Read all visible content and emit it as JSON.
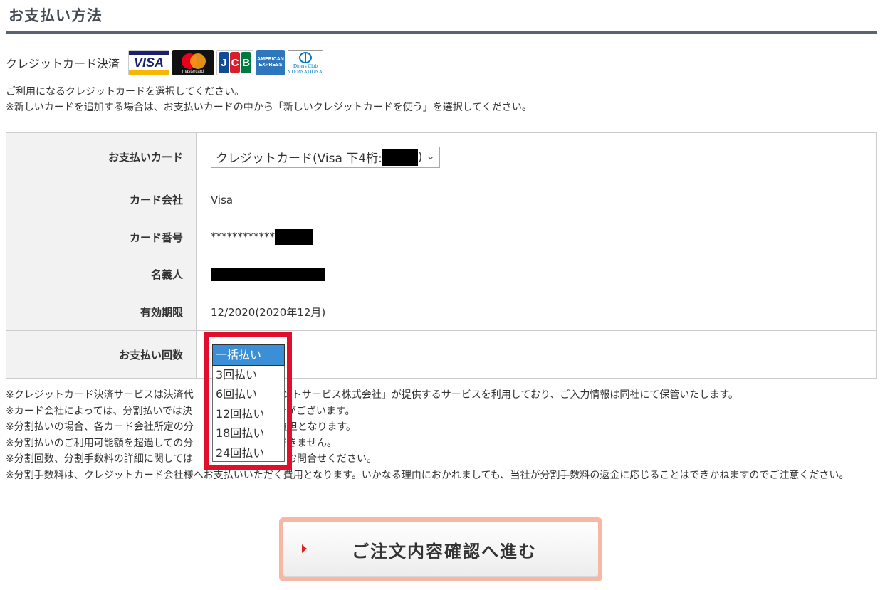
{
  "page_title": "お支払い方法",
  "credit": {
    "label": "クレジットカード決済",
    "logos": [
      {
        "name": "visa",
        "text": "VISA"
      },
      {
        "name": "mastercard",
        "text": "mastercard"
      },
      {
        "name": "jcb",
        "letters": [
          "J",
          "C",
          "B"
        ]
      },
      {
        "name": "amex",
        "text": "AMERICAN EXPRESS"
      },
      {
        "name": "diners",
        "text": "Diners Club INTERNATIONAL"
      }
    ]
  },
  "notes_top": [
    "ご利用になるクレジットカードを選択してください。",
    "※新しいカードを追加する場合は、お支払いカードの中から「新しいクレジットカードを使う」を選択してください。"
  ],
  "table": {
    "card_label": "お支払いカード",
    "card_value": "クレジットカード(Visa 下4桁:",
    "card_value_suffix": ")",
    "company_label": "カード会社",
    "company_value": "Visa",
    "number_label": "カード番号",
    "number_value": "************",
    "holder_label": "名義人",
    "expiry_label": "有効期限",
    "expiry_value": "12/2020(2020年12月)",
    "installments_label": "お支払い回数"
  },
  "installment_options": [
    "一括払い",
    "3回払い",
    "6回払い",
    "12回払い",
    "18回払い",
    "24回払い"
  ],
  "installment_selected": "一括払い",
  "notes_bottom": [
    "※クレジットカード決済サービスは決済代",
    "メントサービス株式会社」が提供するサービスを利用しており、ご入力情報は同社にて保管いたします。",
    "※カード会社によっては、分割払いでは決",
    "合がございます。",
    "※分割払いの場合、各カード会社所定の分",
    "負担となります。",
    "※分割払いのご利用可能額を超過しての分",
    "できません。",
    "※分割回数、分割手数料の詳細に関しては",
    "お問合せください。",
    "※分割手数料は、クレジットカード会社様へお支払いいただく費用となります。いかなる理由におかれましても、当社が分割手数料の返金に応じることはできかねますのでご注意ください。"
  ],
  "submit_label": "ご注文内容確認へ進む",
  "colors": {
    "highlight_box": "#e0102a",
    "selected_option": "#3a8fd6",
    "submit_arrow": "#d9251d"
  }
}
